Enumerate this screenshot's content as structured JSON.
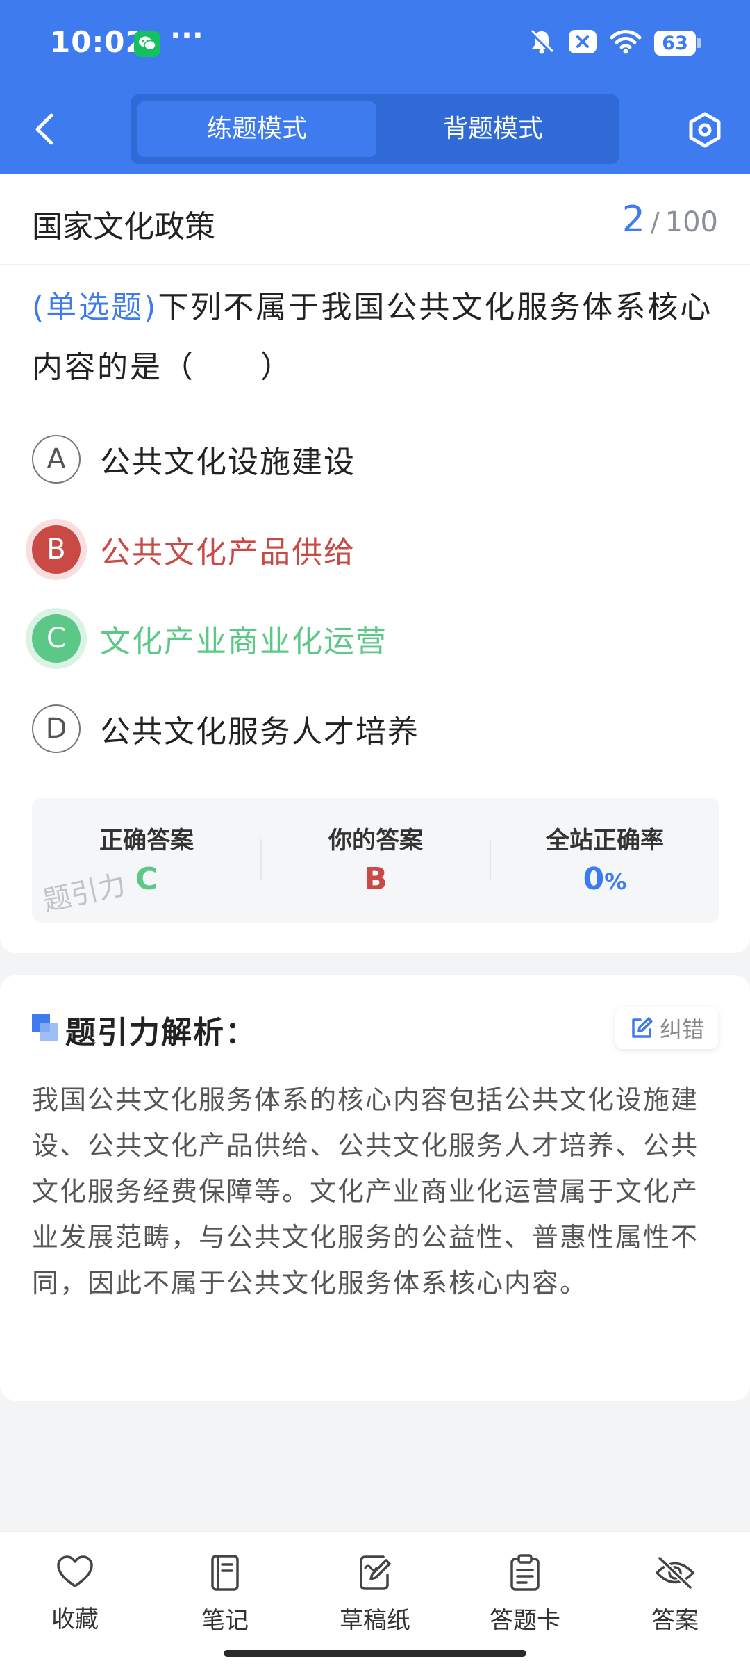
{
  "status_bar": {
    "time": "10:02",
    "dots": "···",
    "battery": "63"
  },
  "nav": {
    "tabs": [
      {
        "label": "练题模式",
        "active": true
      },
      {
        "label": "背题模式",
        "active": false
      }
    ]
  },
  "question": {
    "category": "国家文化政策",
    "current": "2",
    "separator": "/",
    "total": "100",
    "type_label": "(单选题)",
    "text": "下列不属于我国公共文化服务体系核心内容的是（　　）",
    "options": [
      {
        "letter": "A",
        "text": "公共文化设施建设",
        "state": "normal"
      },
      {
        "letter": "B",
        "text": "公共文化产品供给",
        "state": "wrong"
      },
      {
        "letter": "C",
        "text": "文化产业商业化运营",
        "state": "correct"
      },
      {
        "letter": "D",
        "text": "公共文化服务人才培养",
        "state": "normal"
      }
    ]
  },
  "answer_panel": {
    "correct_label": "正确答案",
    "correct_value": "C",
    "yours_label": "你的答案",
    "yours_value": "B",
    "rate_label": "全站正确率",
    "rate_value": "0",
    "rate_unit": "%",
    "watermark": "题引力"
  },
  "analysis": {
    "title": "题引力解析：",
    "report_label": "纠错",
    "body": "我国公共文化服务体系的核心内容包括公共文化设施建设、公共文化产品供给、公共文化服务人才培养、公共文化服务经费保障等。文化产业商业化运营属于文化产业发展范畴，与公共文化服务的公益性、普惠性属性不同，因此不属于公共文化服务体系核心内容。"
  },
  "bottom_bar": {
    "items": [
      {
        "label": "收藏",
        "icon": "heart-icon"
      },
      {
        "label": "笔记",
        "icon": "notebook-icon"
      },
      {
        "label": "草稿纸",
        "icon": "draft-pen-icon"
      },
      {
        "label": "答题卡",
        "icon": "clipboard-icon"
      },
      {
        "label": "答案",
        "icon": "eye-off-icon"
      }
    ]
  },
  "colors": {
    "primary": "#3d7bef",
    "wrong": "#c94945",
    "correct": "#5cc888"
  }
}
